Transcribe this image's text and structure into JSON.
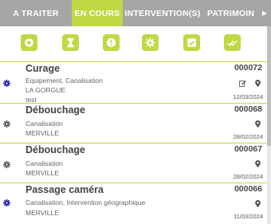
{
  "tabs": [
    {
      "label": "A TRAITER",
      "active": false
    },
    {
      "label": "EN COURS",
      "active": true
    },
    {
      "label": "INTERVENTION(S)",
      "active": false
    },
    {
      "label": "PATRIMOIN",
      "active": false
    }
  ],
  "tab_more_icon": "▶",
  "filter_icons": [
    "stop-icon",
    "hourglass-icon",
    "alert-icon",
    "gear-icon",
    "checkbox-icon",
    "double-check-icon"
  ],
  "colors": {
    "accent": "#c0d843",
    "tabbar": "#a6a6a6",
    "gear_blue": "#1a1aa8",
    "gear_gray": "#555555"
  },
  "items": [
    {
      "title": "Curage",
      "line1": "Equipement, Canalisation",
      "line2": "LA GORGUE",
      "line3": "test",
      "number": "000072",
      "date": "12/03/2024",
      "gear": "blue",
      "edit": true
    },
    {
      "title": "Débouchage",
      "line1": "Canalisation",
      "line2": "MERVILLE",
      "number": "000068",
      "date": "28/02/2024",
      "gear": "gray",
      "edit": false
    },
    {
      "title": "Débouchage",
      "line1": "Canalisation",
      "line2": "MERVILLE",
      "number": "000067",
      "date": "28/02/2024",
      "gear": "gray",
      "edit": false
    },
    {
      "title": "Passage caméra",
      "line1": "Canalisation, Intervention géographique",
      "line2": "MERVILLE",
      "number": "000066",
      "date": "11/03/2024",
      "gear": "blue",
      "edit": false
    }
  ]
}
